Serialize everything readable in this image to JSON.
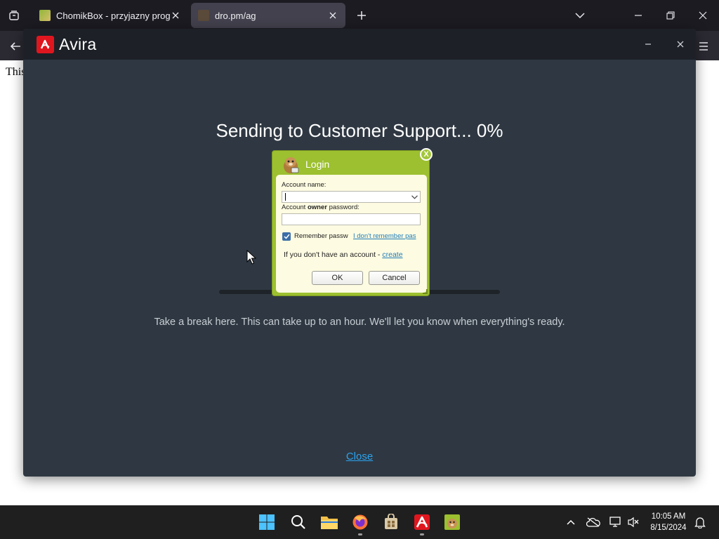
{
  "browser": {
    "tabs": [
      {
        "title": "ChomikBox - przyjazny program",
        "active": false
      },
      {
        "title": "dro.pm/ag",
        "active": true
      }
    ],
    "page_text": "This"
  },
  "avira": {
    "brand": "Avira",
    "heading": "Sending to Customer Support... 0%",
    "progress": 0,
    "subtext": "Take a break here. This can take up to an hour. We'll let you know when everything's ready.",
    "close_link": "Close",
    "accent_color": "#e0161f"
  },
  "login": {
    "title": "Login",
    "close_glyph": "X",
    "account_label": "Account name:",
    "account_value": "",
    "password_label_prefix": "Account ",
    "password_label_bold": "owner",
    "password_label_suffix": " password:",
    "password_value": "",
    "remember_checked": true,
    "remember_label": "Remember passw",
    "forgot_link": "I don't remember pas",
    "no_account_text": "If you don't have an account - ",
    "create_link": "create",
    "ok_label": "OK",
    "cancel_label": "Cancel",
    "frame_color": "#9cc02f"
  },
  "taskbar": {
    "time": "10:05 AM",
    "date": "8/15/2024",
    "apps": [
      "start-icon",
      "search-icon",
      "file-explorer-icon",
      "firefox-icon",
      "store-icon",
      "avira-icon",
      "chomikbox-icon"
    ]
  }
}
